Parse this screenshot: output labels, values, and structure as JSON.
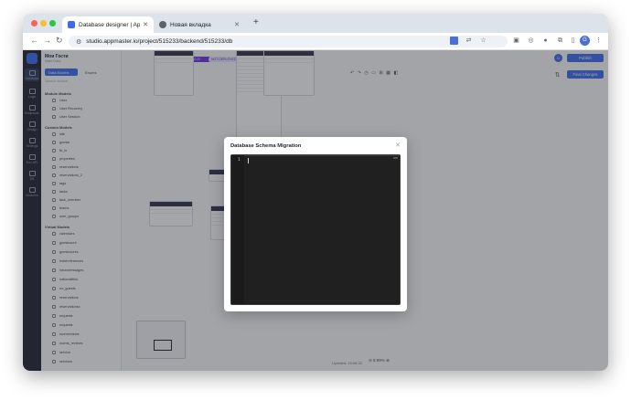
{
  "browser": {
    "tabs": [
      {
        "title": "Database designer | AppMaster",
        "active": true
      },
      {
        "title": "Новая вкладка",
        "active": false
      }
    ],
    "url": "studio.appmaster.io/project/515233/backend/515233/db",
    "profile_initial": "G"
  },
  "app": {
    "project_name": "Мои Гости",
    "project_sub": "Main Data",
    "buttons": {
      "data_models": "Data Models",
      "enums": "Enums"
    },
    "search_placeholder": "Search models",
    "groups": [
      {
        "label": "Module Models",
        "items": [
          "User",
          "User Recovery",
          "User Session"
        ]
      },
      {
        "label": "Custom Models",
        "items": [
          "site",
          "guests",
          "fb_ln",
          "properties",
          "reservations",
          "reservations_2",
          "tags",
          "tasks",
          "task_member",
          "teams",
          "user_groups"
        ]
      },
      {
        "label": "Virtual Models",
        "items": [
          "calendars",
          "guestcount",
          "guestcounts",
          "hotelreferences",
          "inboxmessages",
          "nationalities",
          "no_guests",
          "reservations",
          "reservationsx",
          "requests",
          "requests",
          "roomreviews",
          "rooms_reviews",
          "service",
          "services"
        ]
      }
    ],
    "rail": [
      "Database",
      "Logic",
      "Endpoints",
      "Design",
      "Settings",
      "Env API",
      "DB",
      "Modules"
    ],
    "tags": {
      "branch": "dev1.0.37",
      "status": "NOT DEPLOYED"
    },
    "publish_label": "Publish",
    "user_initial": "G",
    "final_changes_label": "Final Changes",
    "status_text": "Updated: 15:06:32",
    "zoom_level": "8.99%"
  },
  "modal": {
    "title": "Database Schema Migration",
    "line_number": "1"
  },
  "colors": {
    "accent": "#3b6cf0",
    "editor_bg": "#202020",
    "rail": "#1f2330"
  }
}
